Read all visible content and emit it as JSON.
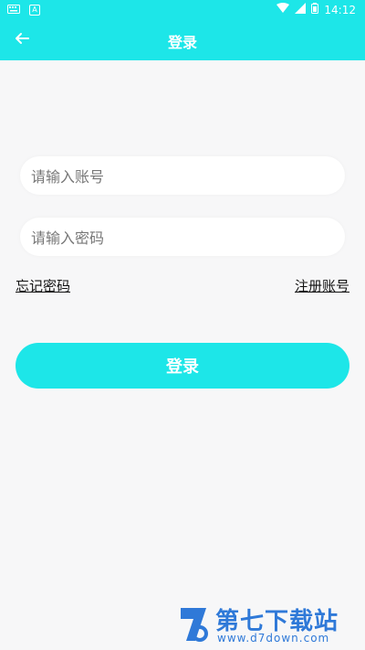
{
  "status_bar": {
    "time": "14:12",
    "left_icons": [
      "keyboard-icon",
      "app-a-icon"
    ],
    "right_icons": [
      "wifi-icon",
      "signal-icon",
      "battery-icon"
    ]
  },
  "app_bar": {
    "title": "登录",
    "back_icon": "arrow-left-icon"
  },
  "form": {
    "account_placeholder": "请输入账号",
    "password_placeholder": "请输入密码",
    "forgot_password_link": "忘记密码",
    "register_link": "注册账号",
    "login_button": "登录"
  },
  "watermark": {
    "brand": "第七下载站",
    "url": "www.d7down.com"
  },
  "colors": {
    "accent": "#1de6e8",
    "background": "#f7f7f8",
    "watermark": "#2f79d8"
  }
}
